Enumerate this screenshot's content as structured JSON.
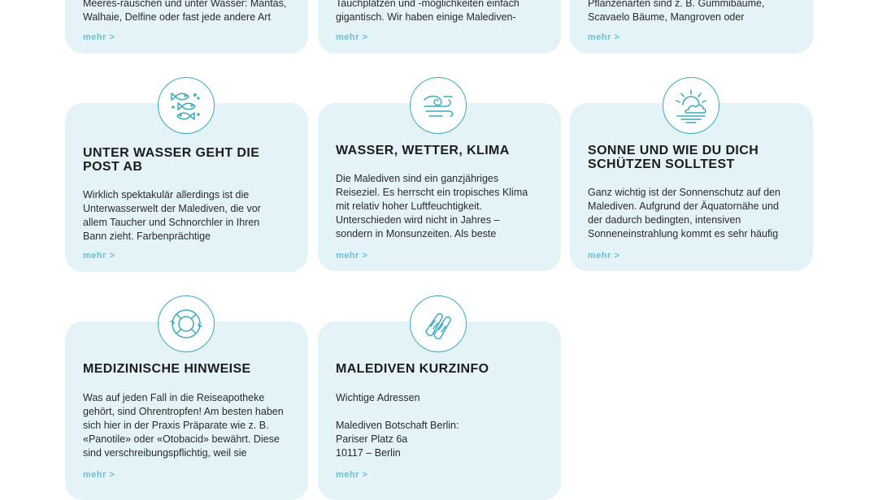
{
  "colors": {
    "accent": "#39a9bf",
    "card_bg": "#e3f3f7",
    "link": "#6cbfd0"
  },
  "more_label": "mehr >",
  "top_row": [
    {
      "line1": "Meeres-rauschen und unter Wasser: Mantas,",
      "line2": "Walhaie, Delfine oder fast jede andere Art"
    },
    {
      "line1": "Tauchplätzen und -möglichkeiten einfach",
      "line2": "gigantisch. Wir haben einige Malediven-"
    },
    {
      "line1": "Pflanzenarten sind z. B. Gummibäume,",
      "line2": "Scavaelo Bäume, Mangroven oder"
    }
  ],
  "cards": [
    {
      "icon": "fish-icon",
      "title": "UNTER WASSER GEHT DIE POST AB",
      "lines": [
        "Wirklich spektakulär allerdings ist die",
        "Unterwasserwelt der Malediven, die vor",
        "allem Taucher und Schnorchler in Ihren",
        "Bann zieht. Farbenprächtige"
      ]
    },
    {
      "icon": "wind-wave-icon",
      "title": "WASSER, WETTER, KLIMA",
      "lines": [
        "Die Malediven sind ein ganzjähriges",
        "Reiseziel. Es herrscht ein tropisches Klima",
        "mit relativ hoher Luftfeuchtigkeit.",
        "Unterschieden wird nicht in Jahres –",
        "sondern in Monsunzeiten. Als beste"
      ]
    },
    {
      "icon": "sun-cloud-icon",
      "title": "SONNE UND WIE DU DICH SCHÜTZEN SOLLTEST",
      "lines": [
        "Ganz wichtig ist der Sonnenschutz auf den",
        "Malediven. Aufgrund der Äquatornähe und",
        "der dadurch bedingten, intensiven",
        "Sonneneinstrahlung kommt es sehr häufig"
      ]
    },
    {
      "icon": "lifebuoy-icon",
      "title": "MEDIZINISCHE HINWEISE",
      "lines": [
        "Was auf jeden Fall in die Reiseapotheke",
        "gehört, sind Ohrentropfen! Am besten haben",
        "sich hier in der Praxis Präparate wie z. B.",
        "«Panotile» oder «Otobacid» bewährt. Diese",
        "sind verschreibungspflichtig, weil sie"
      ]
    },
    {
      "icon": "flippers-icon",
      "title": "MALEDIVEN KURZINFO",
      "lines": [
        "Wichtige Adressen",
        "",
        "Malediven Botschaft Berlin:",
        "Pariser Platz 6a",
        "10117 – Berlin"
      ]
    }
  ]
}
